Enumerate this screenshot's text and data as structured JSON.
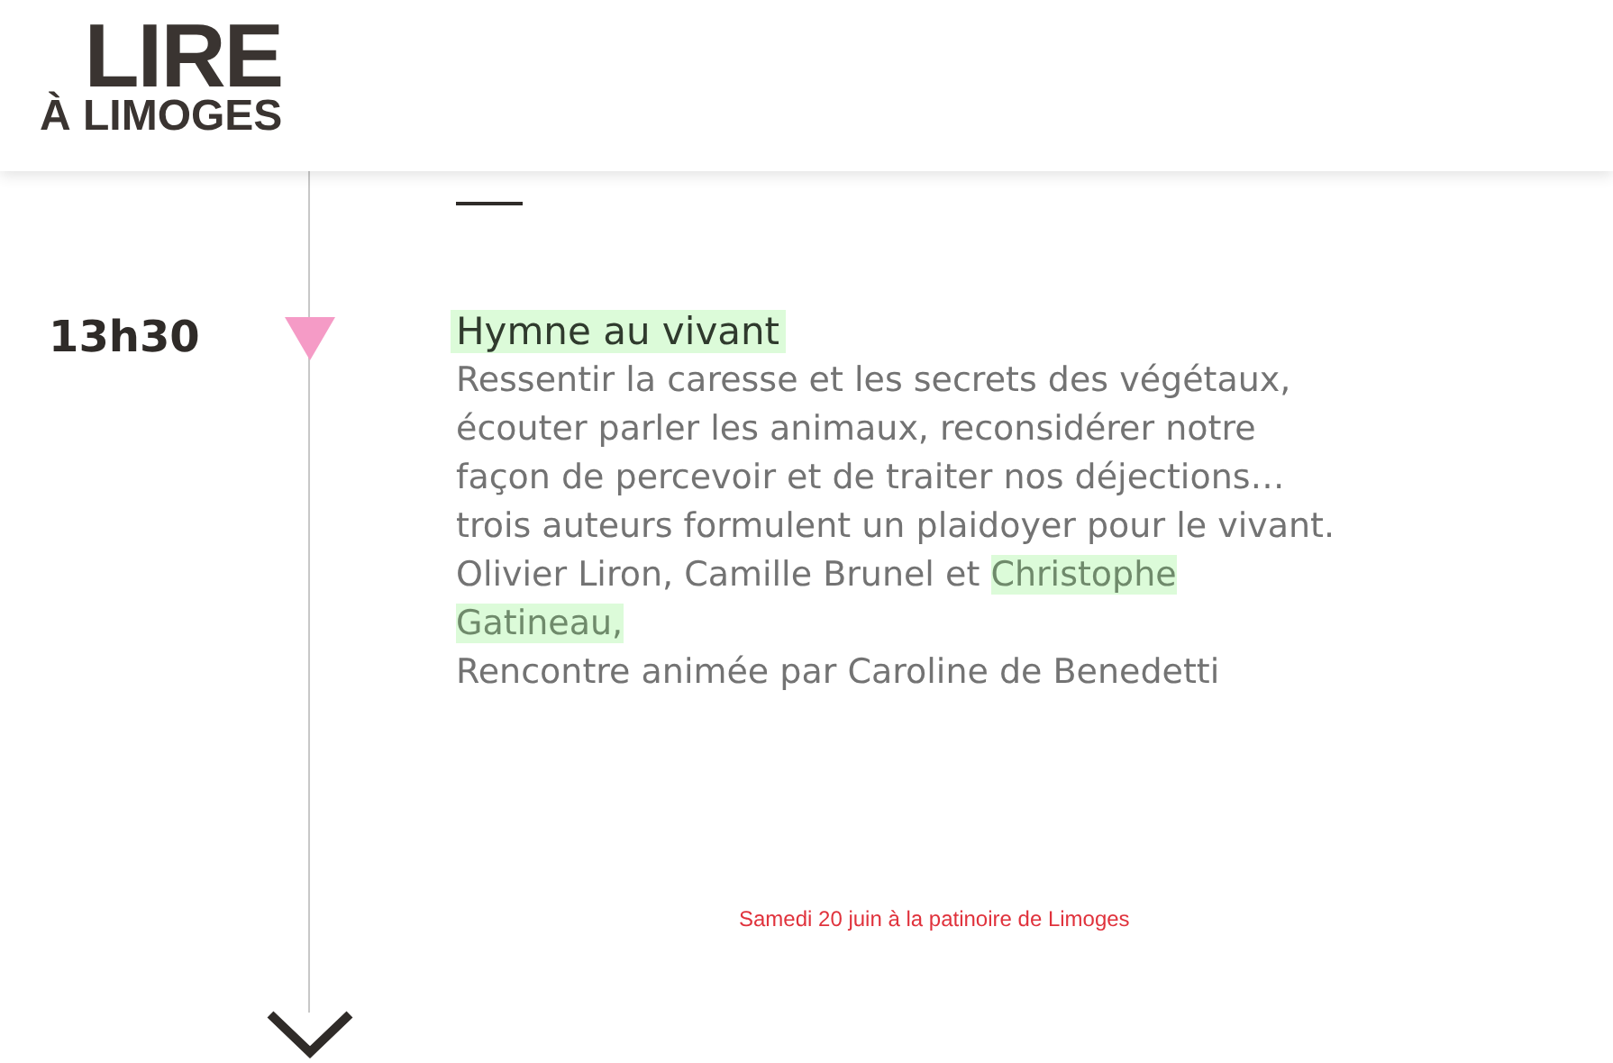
{
  "logo": {
    "line_1": "LIRE",
    "line_2": "À LIMOGES"
  },
  "event": {
    "time": "13h30",
    "title": {
      "text": "Hymne au vivant",
      "highlighted": true
    },
    "description": [
      {
        "text": "Ressentir la caresse et les secrets des végétaux,\nécouter parler les animaux, reconsidérer notre\nfaçon de percevoir et de traiter nos déjections…\ntrois auteurs formulent un plaidoyer pour le vivant.\nOlivier Liron, Camille Brunel et ",
        "highlighted": false
      },
      {
        "text": "Christophe\nGatineau,",
        "highlighted": true
      },
      {
        "text": "\nRencontre animée par Caroline de Benedetti",
        "highlighted": false
      }
    ]
  },
  "footer_note": "Samedi 20 juin à la patinoire de Limoges"
}
